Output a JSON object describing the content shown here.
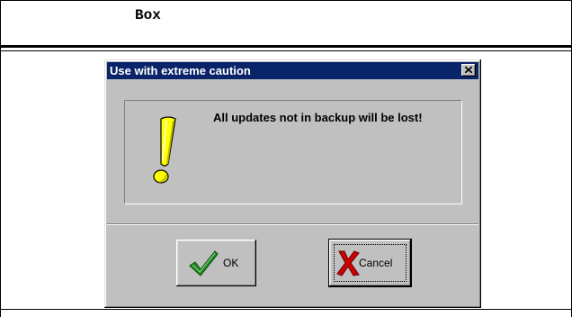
{
  "document": {
    "header_title": "Box"
  },
  "dialog": {
    "title": "Use with extreme caution",
    "message": "All updates not in backup will be lost!",
    "icon": "exclamation-icon",
    "buttons": {
      "ok_label": "OK",
      "ok_icon": "checkmark-icon",
      "cancel_label": "Cancel",
      "cancel_icon": "red-x-icon"
    },
    "colors": {
      "titlebar": "#0a246a",
      "face": "#c0c0c0",
      "exclamation": "#ffff00",
      "check": "#1f8a1f",
      "cross": "#d00000"
    }
  }
}
